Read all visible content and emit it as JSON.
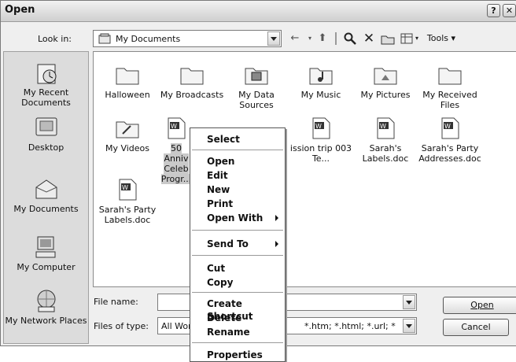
{
  "window": {
    "title": "Open",
    "help": "?",
    "close": "✕"
  },
  "lookin": {
    "label": "Look in:",
    "value": "My Documents"
  },
  "toolbar": {
    "back": "←",
    "up": "⬆",
    "search": "🔍",
    "delete": "✕",
    "newfolder": "📁",
    "views": "▦",
    "tools": "Tools"
  },
  "places": [
    {
      "label": "My Recent Documents"
    },
    {
      "label": "Desktop"
    },
    {
      "label": "My Documents"
    },
    {
      "label": "My Computer"
    },
    {
      "label": "My Network Places"
    }
  ],
  "items": [
    {
      "label": "Halloween",
      "icon": "folder"
    },
    {
      "label": "My Broadcasts",
      "icon": "folder"
    },
    {
      "label": "My Data Sources",
      "icon": "folder-data"
    },
    {
      "label": "My Music",
      "icon": "folder-music"
    },
    {
      "label": "My Pictures",
      "icon": "folder-pictures"
    },
    {
      "label": "My Received Files",
      "icon": "folder"
    },
    {
      "label": "My Videos",
      "icon": "folder-videos"
    },
    {
      "label": "50 Anniv Celeb Progr...",
      "icon": "word-doc",
      "selected": true
    },
    {
      "label": "ission trip 003 Te...",
      "icon": "word-doc"
    },
    {
      "label": "Sarah's Labels.doc",
      "icon": "word-doc"
    },
    {
      "label": "Sarah's Party Addresses.doc",
      "icon": "word-doc"
    },
    {
      "label": "Sarah's Party Labels.doc",
      "icon": "word-doc"
    }
  ],
  "filename": {
    "label": "File name:",
    "value": ""
  },
  "filetype": {
    "label": "Files of type:",
    "value_left": "All Wor",
    "value_right": "*.htm; *.html; *.url; *"
  },
  "buttons": {
    "open": "Open",
    "cancel": "Cancel"
  },
  "menu": {
    "select": "Select",
    "open": "Open",
    "edit": "Edit",
    "new": "New",
    "print": "Print",
    "openwith": "Open With",
    "sendto": "Send To",
    "cut": "Cut",
    "copy": "Copy",
    "shortcut": "Create Shortcut",
    "delete": "Delete",
    "rename": "Rename",
    "properties": "Properties"
  }
}
